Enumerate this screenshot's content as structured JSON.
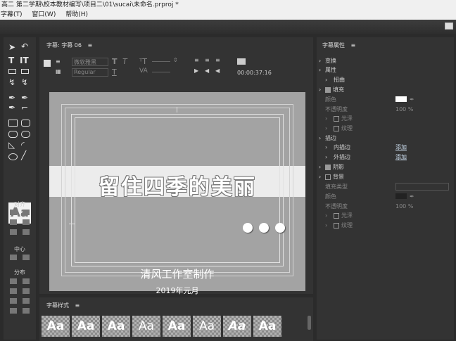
{
  "window": {
    "title": "高二 第二学期\\校本教材编写\\项目二\\01\\sucai\\未命名.prproj *"
  },
  "menu": {
    "items": [
      "字幕(T)",
      "窗口(W)",
      "帮助(H)"
    ]
  },
  "toolbox": {
    "aa_label": "Aa",
    "align_label": "对齐",
    "center_label": "中心",
    "distribute_label": "分布"
  },
  "editor": {
    "panel_title": "字幕: 字幕 06",
    "menu_glyph": "≡",
    "font_family": "微软雅黑",
    "font_style": "Regular",
    "timecode": "00:00:37:16",
    "main_title": "留住四季的美丽",
    "subtitle": "清风工作室制作",
    "date": "2019年元月"
  },
  "styles": {
    "panel_title": "字幕样式",
    "menu_glyph": "≡",
    "swatches": [
      "Aa",
      "Aa",
      "Aa",
      "Aa",
      "Aa",
      "Aa",
      "Aa",
      "Aa"
    ]
  },
  "props": {
    "panel_title": "字幕属性",
    "menu_glyph": "≡",
    "transform": "变换",
    "attributes": "属性",
    "distort": "扭曲",
    "fill": "填充",
    "color": "颜色",
    "opacity": "不透明度",
    "opacity_value": "100 %",
    "sheen": "光泽",
    "texture": "纹理",
    "stroke": "描边",
    "inner_stroke": "内描边",
    "outer_stroke": "外描边",
    "add": "添加",
    "shadow": "阴影",
    "background": "背景",
    "fill_type": "填充类型"
  }
}
